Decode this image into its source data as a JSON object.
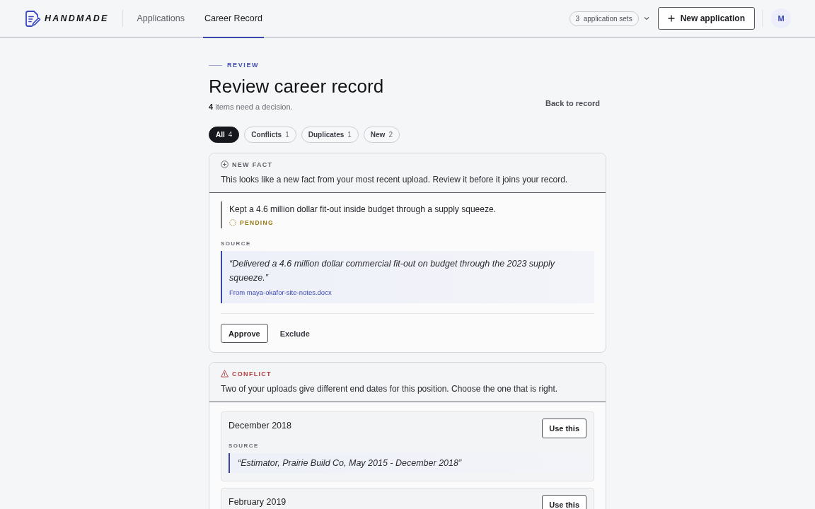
{
  "header": {
    "logo": "HANDMADE",
    "nav": [
      {
        "label": "Applications",
        "selected": false
      },
      {
        "label": "Career Record",
        "selected": true
      }
    ],
    "sets_button": "3  application sets",
    "new_button": "New application",
    "avatar": "M"
  },
  "page": {
    "eyebrow": "REVIEW",
    "title": "Review career record",
    "summary": "**4** items need a decision.",
    "back_link": "Back to record"
  },
  "filters": [
    {
      "label": "All",
      "count": "4",
      "selected": true
    },
    {
      "label": "Conflicts",
      "count": "1",
      "selected": false
    },
    {
      "label": "Duplicates",
      "count": "1",
      "selected": false
    },
    {
      "label": "New",
      "count": "2",
      "selected": false
    }
  ],
  "cards": [
    {
      "kind": "new_fact",
      "tag": "NEW FACT",
      "description": "This looks like a new fact from your most recent upload. Review it before it joins your record.",
      "fact": {
        "text": "Kept a 4.6 million dollar fit-out inside budget through a supply squeeze.",
        "status": {
          "kind": "pending",
          "label": "PENDING"
        }
      },
      "source": {
        "label": "SOURCE",
        "quote": "“Delivered a 4.6 million dollar commercial fit-out on budget through the 2023 supply squeeze.”",
        "file": "From maya-okafor-site-notes.docx"
      },
      "actions": [
        {
          "kind": "outline",
          "label": "Approve"
        },
        {
          "kind": "plain",
          "label": "Exclude"
        }
      ]
    },
    {
      "kind": "conflict",
      "tag": "CONFLICT",
      "description": "Two of your uploads give different end dates for this position. Choose the one that is right.",
      "options": [
        {
          "value": "December 2018",
          "action": "Use this",
          "source": {
            "label": "SOURCE",
            "quote": "“Estimator, Prairie Build Co, May 2015 - December 2018”"
          }
        },
        {
          "value": "February 2019",
          "action": "Use this"
        }
      ]
    }
  ]
}
